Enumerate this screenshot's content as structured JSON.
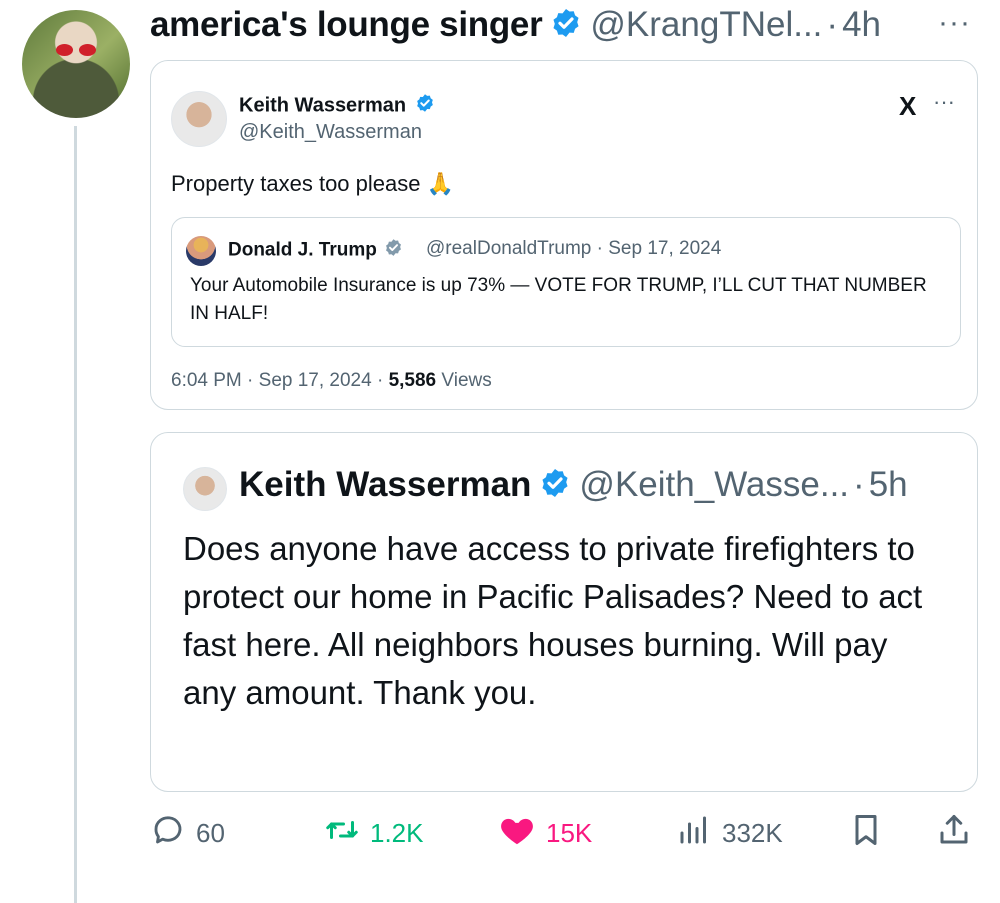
{
  "tweet": {
    "author_name": "america's lounge singer",
    "handle": "@KrangTNel...",
    "separator": "·",
    "time": "4h",
    "more": "···"
  },
  "quote1": {
    "author_name": "Keith Wasserman",
    "handle": "@Keith_Wasserman",
    "text": "Property taxes too please 🙏",
    "more": "···",
    "x_logo": "X",
    "inner": {
      "author_name": "Donald J. Trump",
      "meta": "@realDonaldTrump · Sep 17, 2024",
      "text": "Your Automobile Insurance is up 73% — VOTE FOR TRUMP, I’LL CUT THAT NUMBER IN HALF!"
    },
    "footer": {
      "time": "6:04 PM · Sep 17, 2024 · ",
      "views_count": "5,586",
      "views_label": " Views"
    }
  },
  "quote2": {
    "author_name": "Keith Wasserman",
    "handle": "@Keith_Wasse...",
    "separator": "·",
    "time": "5h",
    "text": "Does anyone have access to private firefighters to protect our home in Pacific Palisades? Need to act fast here. All neighbors houses burning. Will pay any amount. Thank you."
  },
  "actions": {
    "replies": "60",
    "retweets": "1.2K",
    "likes": "15K",
    "views": "332K"
  },
  "colors": {
    "verified": "#1d9bf0",
    "retweet": "#00ba7c",
    "like": "#f91880",
    "secondary_text": "#536471",
    "border": "#cfd9de"
  },
  "icons": [
    "verified-badge-icon",
    "more-icon",
    "x-logo-icon",
    "reply-icon",
    "retweet-icon",
    "like-icon",
    "views-icon",
    "bookmark-icon",
    "share-icon"
  ]
}
